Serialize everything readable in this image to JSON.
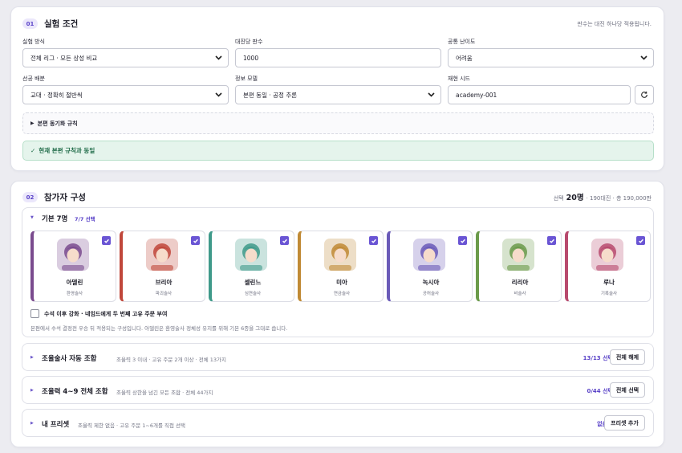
{
  "section1": {
    "num": "01",
    "title": "실험 조건",
    "hint": "판수는 대진 하나당 적용됩니다.",
    "fields": {
      "mode": {
        "label": "실험 방식",
        "value": "전체 리그 · 모든 상성 비교"
      },
      "rounds": {
        "label": "대진당 판수",
        "value": "1000"
      },
      "difficulty": {
        "label": "공통 난이도",
        "value": "어려움"
      },
      "first_move": {
        "label": "선공 배분",
        "value": "교대 · 정확히 절반씩"
      },
      "info_model": {
        "label": "정보 모델",
        "value": "본편 동일 · 공정 추론"
      },
      "seed": {
        "label": "재현 시드",
        "value": "academy-001"
      }
    },
    "details_label": "본편 동기화 규칙",
    "status": "현재 본편 규칙과 동일"
  },
  "section2": {
    "num": "02",
    "title": "참가자 구성",
    "summary_prefix": "선택",
    "summary_count": "20명",
    "summary_rest": "· 190대진 · 총 190,000판",
    "base": {
      "title": "기본 7명",
      "count": "7/7 선택",
      "participants": [
        {
          "name": "아델린",
          "role": "환영술사",
          "color": "#7a4b8e"
        },
        {
          "name": "브리아",
          "role": "파괴술사",
          "color": "#c0473b"
        },
        {
          "name": "셀린느",
          "role": "심연술사",
          "color": "#3f9a8a"
        },
        {
          "name": "미아",
          "role": "연금술사",
          "color": "#c08a35"
        },
        {
          "name": "녹시아",
          "role": "공허술사",
          "color": "#6a5ab8"
        },
        {
          "name": "리리아",
          "role": "비술사",
          "color": "#6b9a4a"
        },
        {
          "name": "루나",
          "role": "기록술사",
          "color": "#b84a6e"
        }
      ],
      "checkbox_label": "수석 이후 강화 · 네임드에게 두 번째 고유 주문 부여",
      "note": "본편에서 수석 결정전 우승 뒤 적용되는 구성입니다. 아델린은 환영술사 정체성 유지를 위해 기본 6종을 그대로 씁니다."
    },
    "groups": [
      {
        "title": "조율술사 자동 조합",
        "sub": "조율력 3 이내 · 고유 주문 2개 이상 · 전체 13가지",
        "count": "13/13 선택",
        "button": "전체 해제"
      },
      {
        "title": "조율력 4~9 전체 조합",
        "sub": "조율력 상한을 넘긴 모든 조합 · 전체 44가지",
        "count": "0/44 선택",
        "button": "전체 선택"
      },
      {
        "title": "내 프리셋",
        "sub": "조율력 제한 없음 · 고유 주문 1~6개를 직접 선택",
        "count": "없음",
        "button": "프리셋 추가"
      }
    ]
  }
}
